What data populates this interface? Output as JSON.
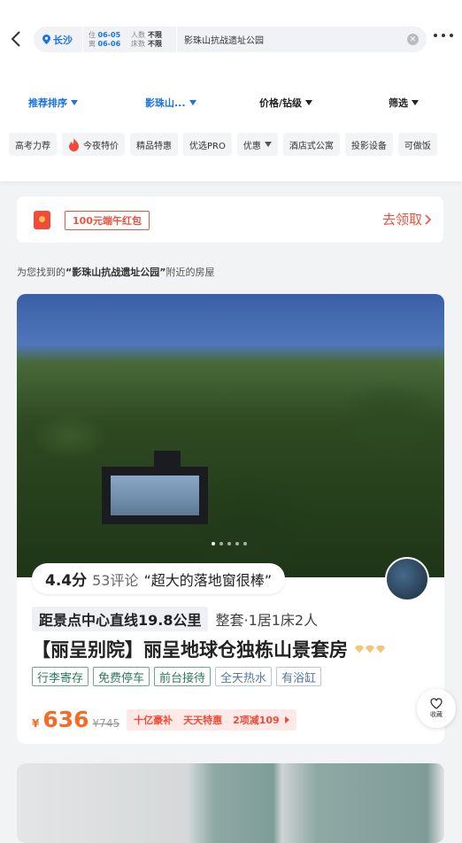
{
  "search": {
    "city": "长沙",
    "checkin_label": "住",
    "checkin": "06-05",
    "checkout_label": "离",
    "checkout": "06-06",
    "guests_label": "人数",
    "guests_value": "不限",
    "beds_label": "床数",
    "beds_value": "不限",
    "keyword": "影珠山抗战遗址公园"
  },
  "sort": {
    "recommend": "推荐排序",
    "location": "影珠山...",
    "price": "价格/钻级",
    "filter": "筛选"
  },
  "chips": [
    "高考力荐",
    "今夜特价",
    "精品特惠",
    "优选PRO",
    "优惠",
    "酒店式公寓",
    "投影设备",
    "可做饭"
  ],
  "promo": {
    "tag": "100元端午红包",
    "cta": "去领取"
  },
  "found": {
    "prefix": "为您找到的",
    "keyword": "“影珠山抗战遗址公园”",
    "suffix": "附近的房屋"
  },
  "listing": {
    "score": "4.4分",
    "reviews": "53评论",
    "quote": "“超大的落地窗很棒”",
    "distance": "距景点中心直线19.8公里",
    "room_type": "整套·1居1床2人",
    "name": "【丽呈别院】丽呈地球仓独栋山景套房",
    "tags_green": [
      "行李寄存",
      "免费停车",
      "前台接待"
    ],
    "tags_blue": [
      "全天热水",
      "有浴缸"
    ],
    "currency": "¥",
    "price": "636",
    "orig_price": "¥745",
    "deal1": "十亿豪补",
    "deal2": "天天特惠",
    "deal3": "2项减109"
  },
  "fav_label": "收藏"
}
